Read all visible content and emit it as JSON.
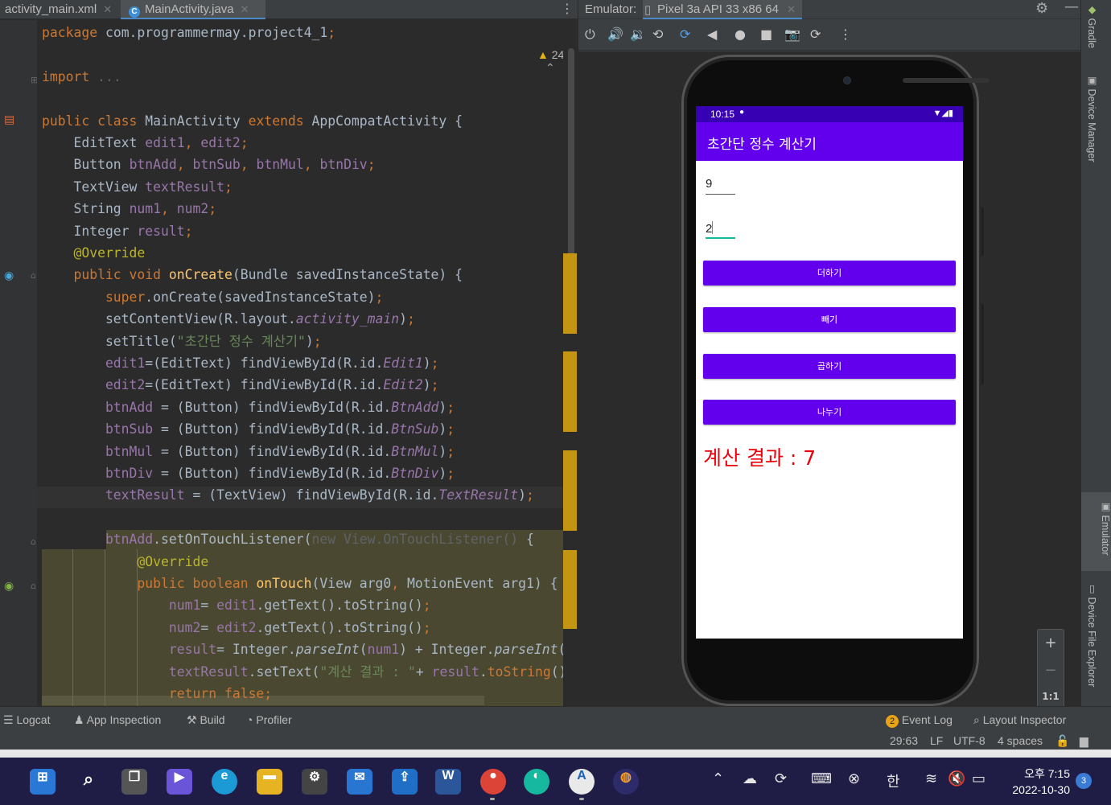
{
  "tabs": [
    {
      "label": "activity_main.xml"
    },
    {
      "label": "MainActivity.java"
    }
  ],
  "editor": {
    "warning_count": "24",
    "lines": [
      {
        "parts": [
          [
            "kw",
            "package "
          ],
          [
            "t",
            "com.programmermay.project4_1"
          ],
          [
            "kw",
            ";"
          ]
        ]
      },
      {
        "parts": []
      },
      {
        "parts": [
          [
            "kw",
            "import "
          ],
          [
            "grey",
            "..."
          ]
        ]
      },
      {
        "parts": []
      },
      {
        "parts": [
          [
            "kw",
            "public class "
          ],
          [
            "t",
            "MainActivity "
          ],
          [
            "kw",
            "extends "
          ],
          [
            "t",
            "AppCompatActivity {"
          ]
        ]
      },
      {
        "parts": [
          [
            "t",
            "    EditText "
          ],
          [
            "fld",
            "edit1"
          ],
          [
            "kw",
            ", "
          ],
          [
            "fld",
            "edit2"
          ],
          [
            "kw",
            ";"
          ]
        ]
      },
      {
        "parts": [
          [
            "t",
            "    Button "
          ],
          [
            "fld",
            "btnAdd"
          ],
          [
            "kw",
            ", "
          ],
          [
            "fld",
            "btnSub"
          ],
          [
            "kw",
            ", "
          ],
          [
            "fld",
            "btnMul"
          ],
          [
            "kw",
            ", "
          ],
          [
            "fld",
            "btnDiv"
          ],
          [
            "kw",
            ";"
          ]
        ]
      },
      {
        "parts": [
          [
            "t",
            "    TextView "
          ],
          [
            "fld",
            "textResult"
          ],
          [
            "kw",
            ";"
          ]
        ]
      },
      {
        "parts": [
          [
            "t",
            "    String "
          ],
          [
            "fld",
            "num1"
          ],
          [
            "kw",
            ", "
          ],
          [
            "fld",
            "num2"
          ],
          [
            "kw",
            ";"
          ]
        ]
      },
      {
        "parts": [
          [
            "t",
            "    Integer "
          ],
          [
            "fld",
            "result"
          ],
          [
            "kw",
            ";"
          ]
        ]
      },
      {
        "parts": [
          [
            "ann",
            "    @Override"
          ]
        ]
      },
      {
        "parts": [
          [
            "kw",
            "    public void "
          ],
          [
            "fn",
            "onCreate"
          ],
          [
            "t",
            "(Bundle savedInstanceState) {"
          ]
        ]
      },
      {
        "parts": [
          [
            "kw",
            "        super"
          ],
          [
            "t",
            ".onCreate(savedInstanceState)"
          ],
          [
            "kw",
            ";"
          ]
        ]
      },
      {
        "parts": [
          [
            "t",
            "        setContentView(R.layout."
          ],
          [
            "it",
            "activity_main"
          ],
          [
            "t",
            ")"
          ],
          [
            "kw",
            ";"
          ]
        ]
      },
      {
        "parts": [
          [
            "t",
            "        setTitle("
          ],
          [
            "str",
            "\"초간단 정수 계산기\""
          ],
          [
            "t",
            ")"
          ],
          [
            "kw",
            ";"
          ]
        ]
      },
      {
        "parts": [
          [
            "fld",
            "        edit1"
          ],
          [
            "t",
            "=(EditText) findViewById(R.id."
          ],
          [
            "it",
            "Edit1"
          ],
          [
            "t",
            ")"
          ],
          [
            "kw",
            ";"
          ]
        ]
      },
      {
        "parts": [
          [
            "fld",
            "        edit2"
          ],
          [
            "t",
            "=(EditText) findViewById(R.id."
          ],
          [
            "it",
            "Edit2"
          ],
          [
            "t",
            ")"
          ],
          [
            "kw",
            ";"
          ]
        ]
      },
      {
        "parts": [
          [
            "fld",
            "        btnAdd "
          ],
          [
            "t",
            "= (Button) findViewById(R.id."
          ],
          [
            "it",
            "BtnAdd"
          ],
          [
            "t",
            ")"
          ],
          [
            "kw",
            ";"
          ]
        ]
      },
      {
        "parts": [
          [
            "fld",
            "        btnSub "
          ],
          [
            "t",
            "= (Button) findViewById(R.id."
          ],
          [
            "it",
            "BtnSub"
          ],
          [
            "t",
            ")"
          ],
          [
            "kw",
            ";"
          ]
        ]
      },
      {
        "parts": [
          [
            "fld",
            "        btnMul "
          ],
          [
            "t",
            "= (Button) findViewById(R.id."
          ],
          [
            "it",
            "BtnMul"
          ],
          [
            "t",
            ")"
          ],
          [
            "kw",
            ";"
          ]
        ]
      },
      {
        "parts": [
          [
            "fld",
            "        btnDiv "
          ],
          [
            "t",
            "= (Button) findViewById(R.id."
          ],
          [
            "it",
            "BtnDiv"
          ],
          [
            "t",
            ")"
          ],
          [
            "kw",
            ";"
          ]
        ]
      },
      {
        "parts": [
          [
            "fld",
            "        textResult "
          ],
          [
            "t",
            "= (TextView) findViewById(R.id."
          ],
          [
            "it",
            "TextResult"
          ],
          [
            "t",
            ")"
          ],
          [
            "kw",
            ";"
          ]
        ]
      },
      {
        "parts": []
      },
      {
        "parts": [
          [
            "fld",
            "        btnAdd"
          ],
          [
            "t",
            ".setOnTouchListener("
          ],
          [
            "grey",
            "new View.OnTouchListener() "
          ],
          [
            "t",
            "{"
          ]
        ]
      },
      {
        "parts": [
          [
            "ann",
            "            @Override"
          ]
        ]
      },
      {
        "parts": [
          [
            "kw",
            "            public boolean "
          ],
          [
            "fn",
            "onTouch"
          ],
          [
            "t",
            "(View arg0"
          ],
          [
            "kw",
            ", "
          ],
          [
            "t",
            "MotionEvent arg1) {"
          ]
        ]
      },
      {
        "parts": [
          [
            "fld",
            "                num1"
          ],
          [
            "t",
            "= "
          ],
          [
            "fld",
            "edit1"
          ],
          [
            "t",
            ".getText().toString()"
          ],
          [
            "kw",
            ";"
          ]
        ]
      },
      {
        "parts": [
          [
            "fld",
            "                num2"
          ],
          [
            "t",
            "= "
          ],
          [
            "fld",
            "edit2"
          ],
          [
            "t",
            ".getText().toString()"
          ],
          [
            "kw",
            ";"
          ]
        ]
      },
      {
        "parts": [
          [
            "fld",
            "                result"
          ],
          [
            "t",
            "= Integer."
          ],
          [
            "sit",
            "parseInt"
          ],
          [
            "t",
            "("
          ],
          [
            "fld",
            "num1"
          ],
          [
            "t",
            ") + Integer."
          ],
          [
            "sit",
            "parseInt"
          ],
          [
            "t",
            "(n"
          ]
        ]
      },
      {
        "parts": [
          [
            "fld",
            "                textResult"
          ],
          [
            "t",
            ".setText("
          ],
          [
            "str",
            "\"계산 결과 : \""
          ],
          [
            "t",
            "+ "
          ],
          [
            "fld",
            "result"
          ],
          [
            "t",
            "."
          ],
          [
            "kw",
            "toString"
          ],
          [
            "t",
            "()"
          ]
        ]
      },
      {
        "parts": [
          [
            "kw",
            "                return false;"
          ]
        ]
      }
    ]
  },
  "emulator": {
    "label": "Emulator:",
    "device_tab": "Pixel 3a API 33 x86 64",
    "phone": {
      "time": "10:15",
      "app_title": "초간단 정수 계산기",
      "edit1_value": "9",
      "edit2_value": "2",
      "buttons": [
        "더하기",
        "빼기",
        "곱하기",
        "나누기"
      ],
      "result_text": "계산 결과 : 7",
      "colors": {
        "primary": "#6200ee",
        "status": "#3700b3",
        "result": "#e8000b",
        "accent": "#14b8a6"
      }
    },
    "zoom": {
      "plus": "+",
      "minus": "−",
      "one_to_one": "1:1"
    }
  },
  "right_sidebar": [
    "Gradle",
    "Device Manager",
    "Emulator",
    "Device File Explorer"
  ],
  "tool_windows": {
    "left": [
      "Logcat",
      "App Inspection",
      "Build",
      "Profiler"
    ],
    "right": [
      {
        "badge": "2",
        "label": "Event Log"
      },
      {
        "label": "Layout Inspector"
      }
    ]
  },
  "status": {
    "position": "29:63",
    "line_sep": "LF",
    "encoding": "UTF-8",
    "indent": "4 spaces"
  },
  "taskbar": {
    "ime": "한",
    "clock_time": "오후 7:15",
    "clock_date": "2022-10-30",
    "notifications": "3"
  }
}
